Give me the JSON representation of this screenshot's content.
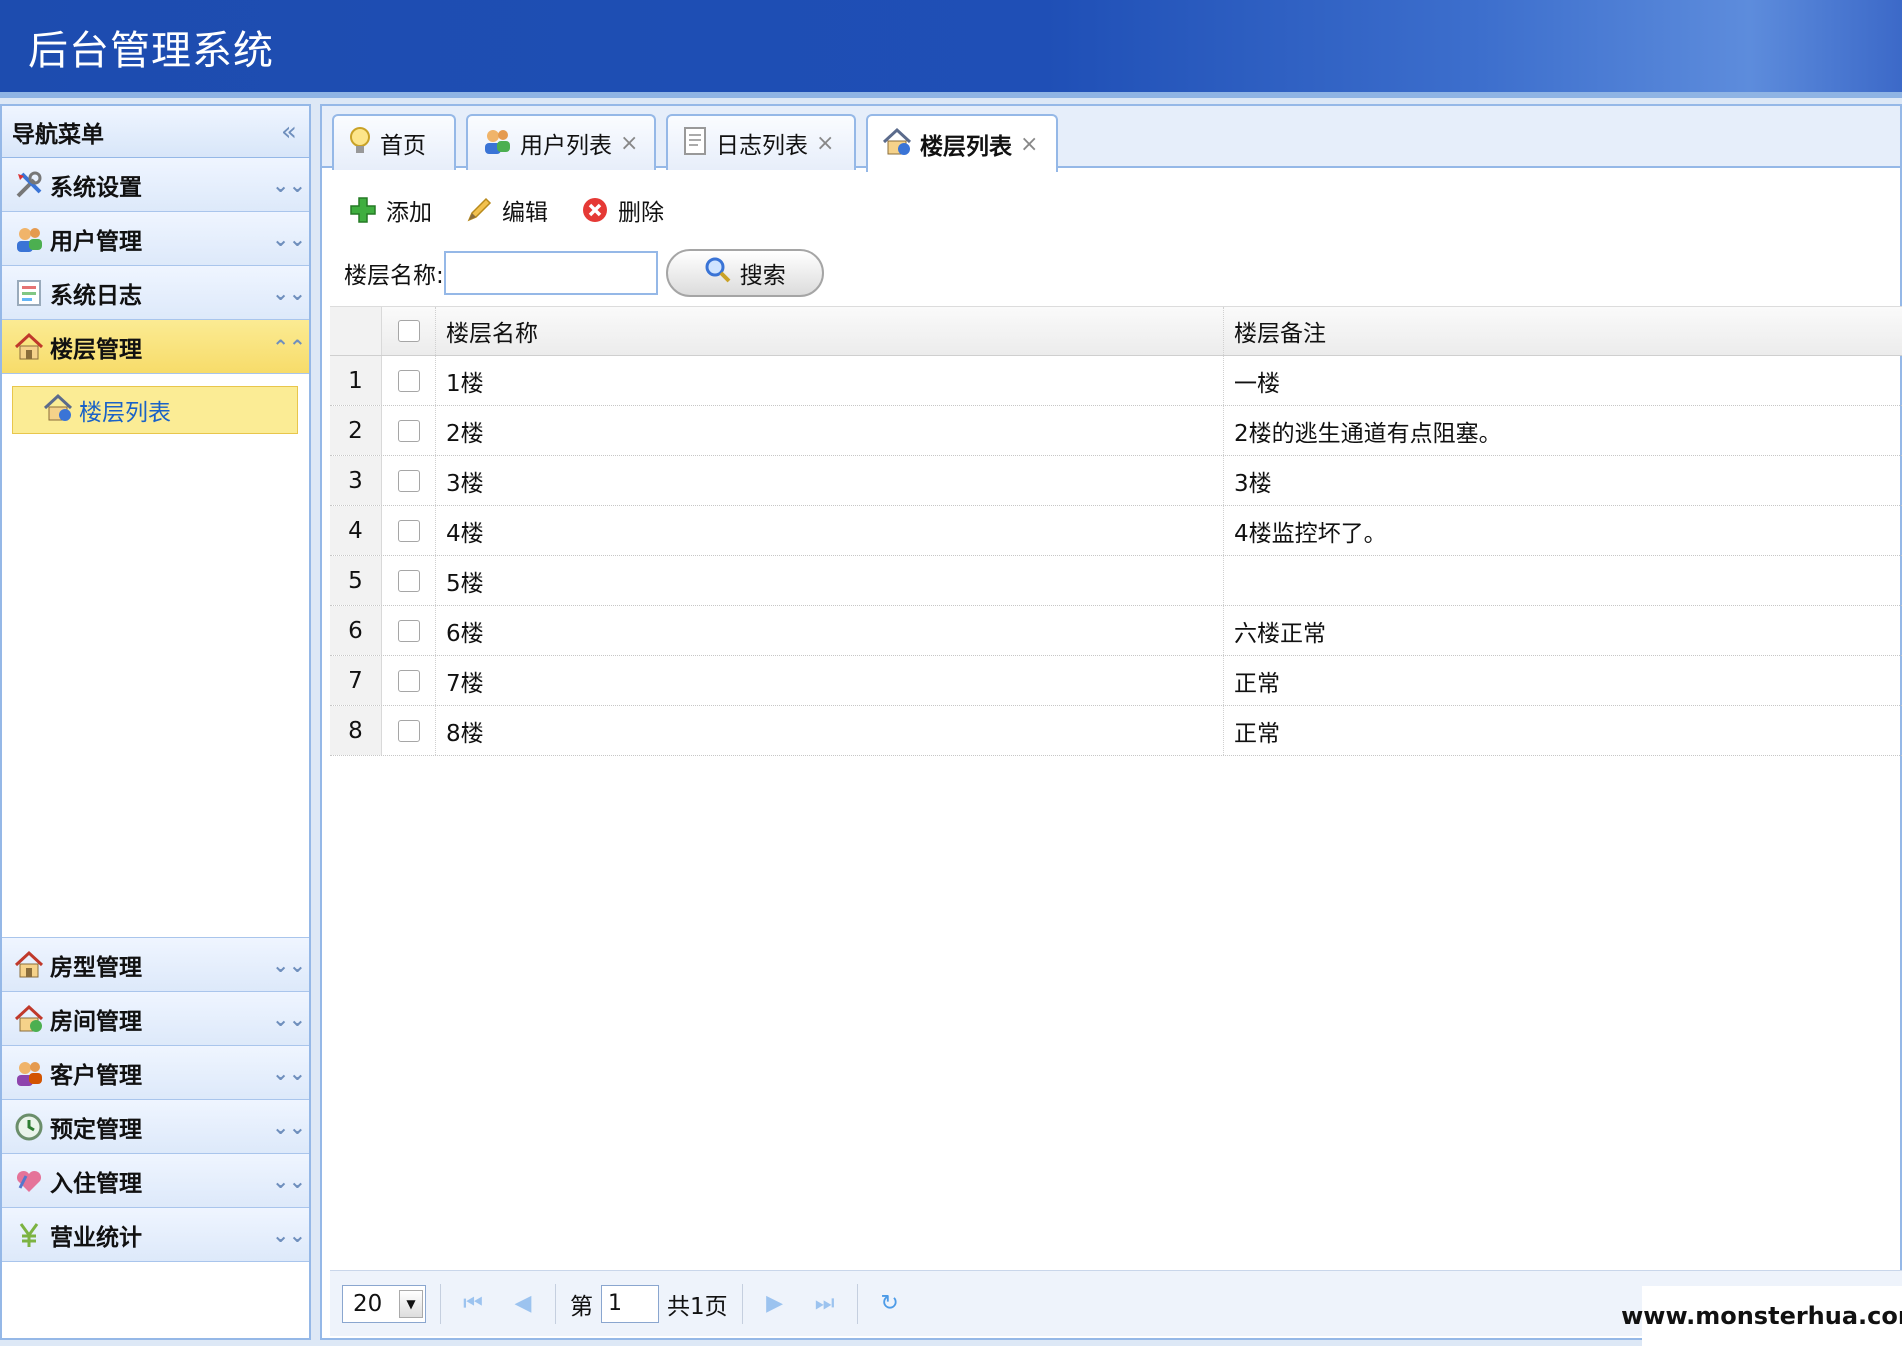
{
  "app": {
    "title": "后台管理系统"
  },
  "sidebar": {
    "header": "导航菜单",
    "sections": [
      {
        "label": "系统设置",
        "icon": "tools-icon"
      },
      {
        "label": "用户管理",
        "icon": "users-icon"
      },
      {
        "label": "系统日志",
        "icon": "log-icon"
      },
      {
        "label": "楼层管理",
        "icon": "house-icon",
        "active": true
      },
      {
        "label": "房型管理",
        "icon": "house-icon"
      },
      {
        "label": "房间管理",
        "icon": "house-icon"
      },
      {
        "label": "客户管理",
        "icon": "users-icon"
      },
      {
        "label": "预定管理",
        "icon": "clock-icon"
      },
      {
        "label": "入住管理",
        "icon": "heart-icon"
      },
      {
        "label": "营业统计",
        "icon": "yen-icon"
      }
    ],
    "active_subitem": "楼层列表"
  },
  "tabs": [
    {
      "label": "首页",
      "closable": false
    },
    {
      "label": "用户列表",
      "closable": true
    },
    {
      "label": "日志列表",
      "closable": true
    },
    {
      "label": "楼层列表",
      "closable": true,
      "active": true
    }
  ],
  "toolbar": {
    "add": "添加",
    "edit": "编辑",
    "delete": "删除"
  },
  "search": {
    "label": "楼层名称:",
    "value": "",
    "button": "搜索"
  },
  "table": {
    "columns": [
      "楼层名称",
      "楼层备注"
    ],
    "rows": [
      {
        "num": "1",
        "name": "1楼",
        "note": "一楼"
      },
      {
        "num": "2",
        "name": "2楼",
        "note": "2楼的逃生通道有点阻塞。"
      },
      {
        "num": "3",
        "name": "3楼",
        "note": "3楼"
      },
      {
        "num": "4",
        "name": "4楼",
        "note": "4楼监控坏了。"
      },
      {
        "num": "5",
        "name": "5楼",
        "note": ""
      },
      {
        "num": "6",
        "name": "6楼",
        "note": "六楼正常"
      },
      {
        "num": "7",
        "name": "7楼",
        "note": "正常"
      },
      {
        "num": "8",
        "name": "8楼",
        "note": "正常"
      }
    ]
  },
  "pager": {
    "page_size": "20",
    "page_prefix": "第",
    "page_value": "1",
    "page_total": "共1页"
  },
  "watermark": "www.monsterhua.com",
  "colors": {
    "header": "#1f4fb6",
    "active_section": "#f7dc6a",
    "border": "#95b8e7"
  }
}
